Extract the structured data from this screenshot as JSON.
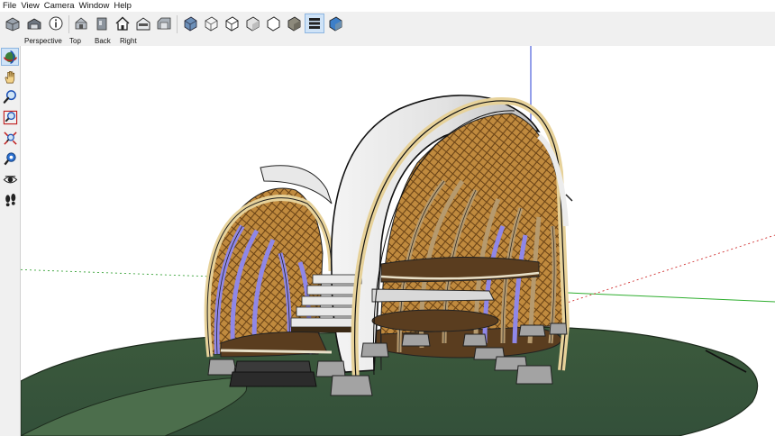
{
  "menu": {
    "items": [
      "File",
      "View",
      "Camera",
      "Window",
      "Help"
    ]
  },
  "views": {
    "perspective": "Perspective",
    "top": "Top",
    "back": "Back",
    "right": "Right"
  },
  "toolbar_icons": [
    "open-model-icon",
    "3d-warehouse-icon",
    "model-info-icon",
    "iso-view-icon",
    "front-view-icon",
    "home-icon",
    "section-view-icon",
    "left-view-icon",
    "xray-style-icon",
    "wireframe-style-icon",
    "hidden-line-style-icon",
    "shaded-style-icon",
    "textured-style-icon",
    "monochrome-style-icon",
    "materials-style-icon"
  ],
  "side_tools": [
    "orbit-icon",
    "pan-icon",
    "zoom-icon",
    "zoom-window-icon",
    "zoom-extents-icon",
    "position-camera-icon",
    "look-around-icon",
    "walk-icon"
  ]
}
